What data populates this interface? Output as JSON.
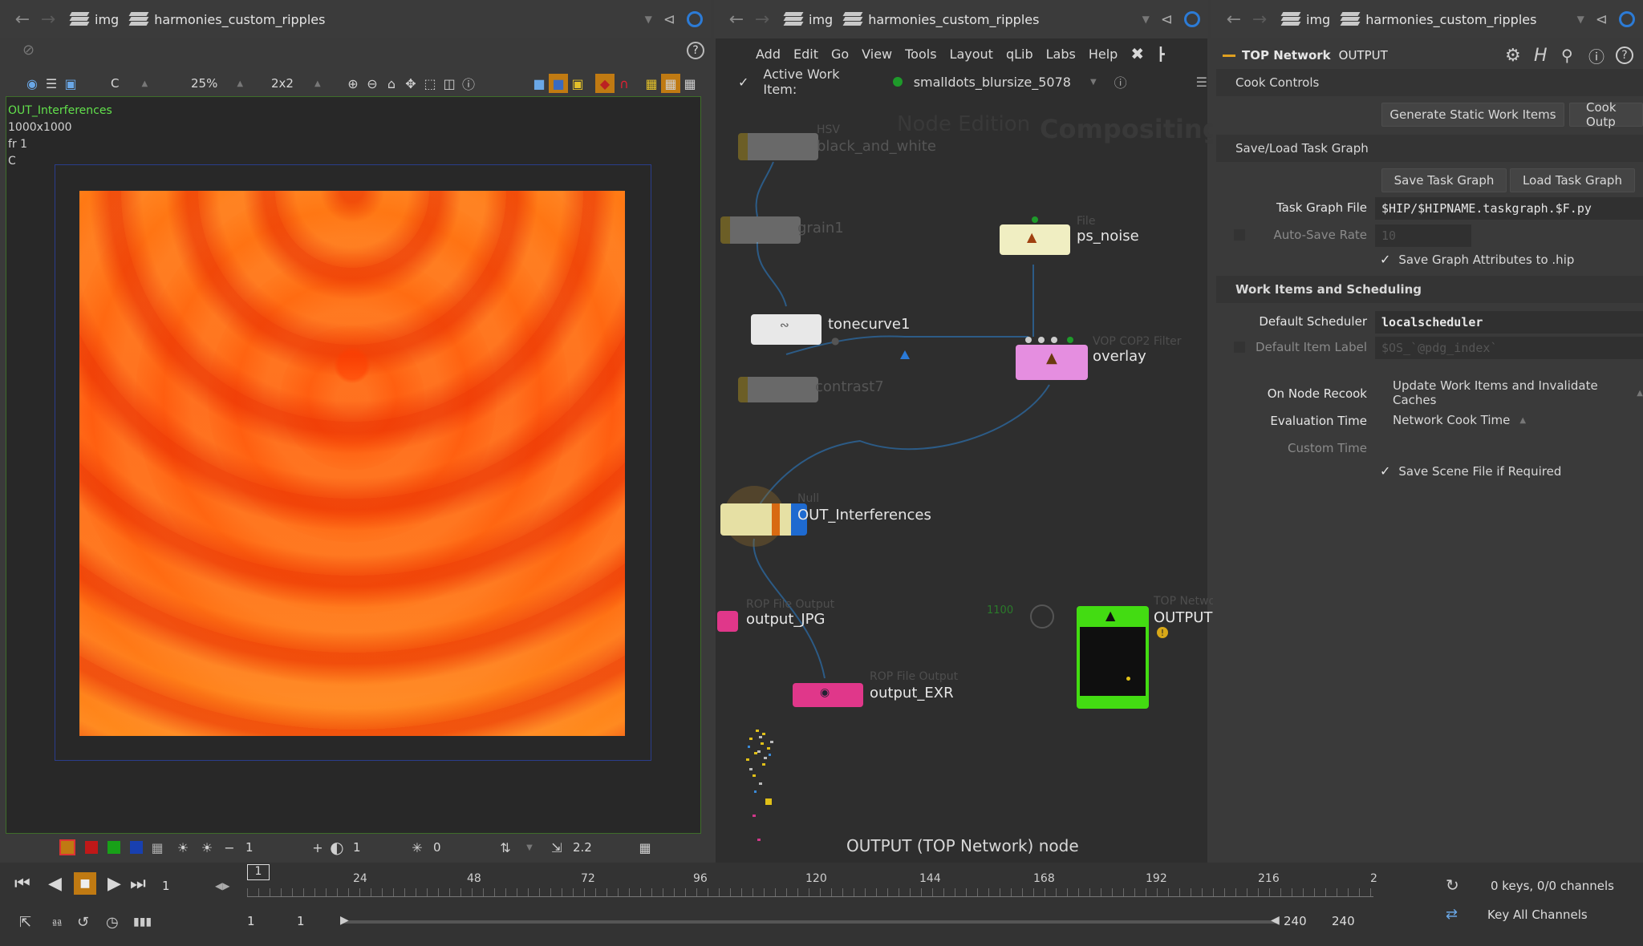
{
  "header": {
    "crumb_root": "img",
    "crumb_network": "harmonies_custom_ripples"
  },
  "viewer": {
    "toolbar": {
      "channel": "C",
      "zoom": "25%",
      "grid": "2x2"
    },
    "info": {
      "node_name": "OUT_Interferences",
      "resolution": "1000x1000",
      "frame": "fr 1",
      "plane": "C"
    },
    "bottom": {
      "minus_value": "1",
      "contrast_value": "1",
      "exposure_value": "0",
      "gamma_value": "2.2"
    }
  },
  "network": {
    "menu": [
      "Add",
      "Edit",
      "Go",
      "View",
      "Tools",
      "Layout",
      "qLib",
      "Labs",
      "Help"
    ],
    "active_work_item_label": "Active Work Item:",
    "active_work_item_value": "smalldots_blursize_5078",
    "watermark_context": "Compositing",
    "watermark_edition": "Node Edition",
    "nodes": {
      "hsv": {
        "type": "HSV",
        "name": "black_and_white"
      },
      "grain": {
        "name": "grain1"
      },
      "ps_noise": {
        "type": "File",
        "name": "ps_noise"
      },
      "tonecurve": {
        "name": "tonecurve1"
      },
      "overlay": {
        "type": "VOP COP2 Filter",
        "name": "overlay"
      },
      "contrast": {
        "name": "contrast7"
      },
      "out": {
        "type": "Null",
        "name": "OUT_Interferences"
      },
      "output_jpg": {
        "type": "ROP File Output",
        "name": "output_JPG"
      },
      "output_exr": {
        "type": "ROP File Output",
        "name": "output_EXR"
      },
      "top_output": {
        "type": "TOP Network",
        "name": "OUTPUT"
      },
      "counter": "1100"
    },
    "status": "OUTPUT (TOP Network) node"
  },
  "params": {
    "header_type": "TOP Network",
    "header_name": "OUTPUT",
    "sections": {
      "cook_controls": "Cook Controls",
      "save_load": "Save/Load Task Graph",
      "work_items": "Work Items and Scheduling"
    },
    "buttons": {
      "generate": "Generate Static Work Items",
      "cook_output": "Cook Outp",
      "save_graph": "Save Task Graph",
      "load_graph": "Load Task Graph"
    },
    "fields": {
      "task_graph_file_label": "Task Graph File",
      "task_graph_file_value": "$HIP/$HIPNAME.taskgraph.$F.py",
      "auto_save_rate_label": "Auto-Save Rate",
      "auto_save_rate_value": "10",
      "save_graph_attrs_label": "Save Graph Attributes to .hip",
      "default_scheduler_label": "Default Scheduler",
      "default_scheduler_value": "localscheduler",
      "default_item_label_label": "Default Item Label",
      "default_item_label_value": "$OS_`@pdg_index`",
      "on_node_recook_label": "On Node Recook",
      "on_node_recook_value": "Update Work Items and Invalidate Caches",
      "evaluation_time_label": "Evaluation Time",
      "evaluation_time_value": "Network Cook Time",
      "custom_time_label": "Custom Time",
      "save_scene_label": "Save Scene File if Required"
    }
  },
  "timeline": {
    "current_frame": "1",
    "ticks": [
      "1",
      "24",
      "48",
      "72",
      "96",
      "120",
      "144",
      "168",
      "192",
      "216",
      "2"
    ],
    "range_start": "1",
    "range_start2": "1",
    "range_end": "240",
    "range_end2": "240",
    "keys_info": "0 keys, 0/0 channels",
    "key_all": "Key All Channels"
  }
}
